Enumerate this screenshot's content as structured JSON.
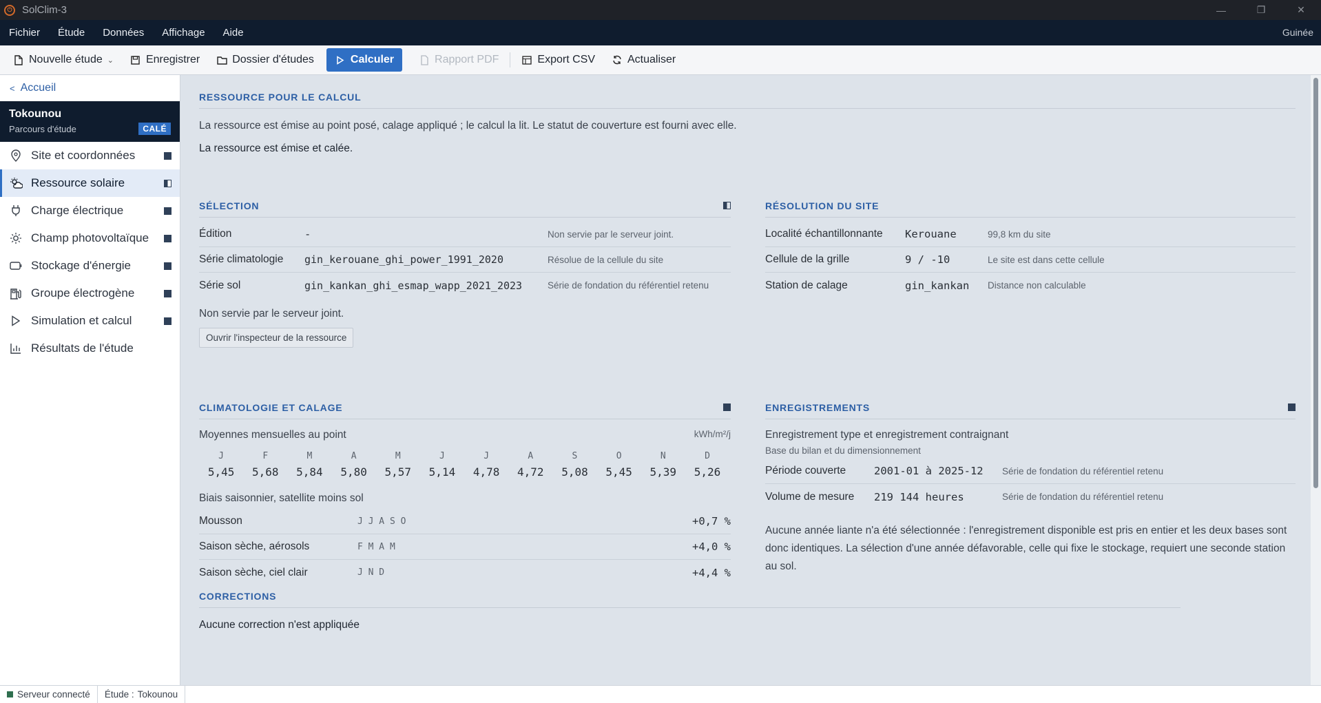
{
  "window": {
    "title": "SolClim-3",
    "minimize": "—",
    "restore": "❐",
    "close": "✕"
  },
  "menu": {
    "items": [
      "Fichier",
      "Étude",
      "Données",
      "Affichage",
      "Aide"
    ],
    "country": "Guinée"
  },
  "toolbar": {
    "new_study": "Nouvelle étude",
    "save": "Enregistrer",
    "folder": "Dossier d'études",
    "compute": "Calculer",
    "pdf": "Rapport PDF",
    "csv": "Export CSV",
    "refresh": "Actualiser"
  },
  "sidebar": {
    "back": "Accueil",
    "study_name": "Tokounou",
    "study_sub": "Parcours d'étude",
    "badge": "CALÉ",
    "items": [
      {
        "label": "Site et coordonnées",
        "icon": "map-pin-icon"
      },
      {
        "label": "Ressource solaire",
        "icon": "sun-cloud-icon"
      },
      {
        "label": "Charge électrique",
        "icon": "plug-icon"
      },
      {
        "label": "Champ photovoltaïque",
        "icon": "sun-icon"
      },
      {
        "label": "Stockage d'énergie",
        "icon": "battery-icon"
      },
      {
        "label": "Groupe électrogène",
        "icon": "generator-icon"
      },
      {
        "label": "Simulation et calcul",
        "icon": "play-icon"
      },
      {
        "label": "Résultats de l'étude",
        "icon": "bar-chart-icon"
      }
    ]
  },
  "resource": {
    "title": "RESSOURCE POUR LE CALCUL",
    "desc": "La ressource est émise au point posé, calage appliqué ; le calcul la lit. Le statut de couverture est fourni avec elle.",
    "status": "La ressource est émise et calée."
  },
  "selection": {
    "title": "SÉLECTION",
    "rows": [
      {
        "label": "Édition",
        "value": "-",
        "note": "Non servie par le serveur joint."
      },
      {
        "label": "Série climatologie",
        "value": "gin_kerouane_ghi_power_1991_2020",
        "note": "Résolue de la cellule du site"
      },
      {
        "label": "Série sol",
        "value": "gin_kankan_ghi_esmap_wapp_2021_2023",
        "note": "Série de fondation du référentiel retenu"
      }
    ],
    "footnote": "Non servie par le serveur joint.",
    "inspector_button": "Ouvrir l'inspecteur de la ressource"
  },
  "site_resolution": {
    "title": "RÉSOLUTION DU SITE",
    "rows": [
      {
        "label": "Localité échantillonnante",
        "value": "Kerouane",
        "note": "99,8 km du site"
      },
      {
        "label": "Cellule de la grille",
        "value": "9 / -10",
        "note": "Le site est dans cette cellule"
      },
      {
        "label": "Station de calage",
        "value": "gin_kankan",
        "note": "Distance non calculable"
      }
    ]
  },
  "climatology": {
    "title": "CLIMATOLOGIE ET CALAGE",
    "subtitle": "Moyennes mensuelles au point",
    "unit": "kWh/m²/j",
    "months": [
      "J",
      "F",
      "M",
      "A",
      "M",
      "J",
      "J",
      "A",
      "S",
      "O",
      "N",
      "D"
    ],
    "values": [
      "5,45",
      "5,68",
      "5,84",
      "5,80",
      "5,57",
      "5,14",
      "4,78",
      "4,72",
      "5,08",
      "5,45",
      "5,39",
      "5,26"
    ],
    "bias_title": "Biais saisonnier, satellite moins sol",
    "bias": [
      {
        "season": "Mousson",
        "months": "J J A S O",
        "value": "+0,7 %"
      },
      {
        "season": "Saison sèche, aérosols",
        "months": "F M A M",
        "value": "+4,0 %"
      },
      {
        "season": "Saison sèche, ciel clair",
        "months": "J N D",
        "value": "+4,4 %"
      }
    ]
  },
  "records": {
    "title": "ENREGISTREMENTS",
    "subtitle": "Enregistrement type et enregistrement contraignant",
    "sub2": "Base du bilan et du dimensionnement",
    "rows": [
      {
        "label": "Période couverte",
        "value": "2001-01 à 2025-12",
        "note": "Série de fondation du référentiel retenu"
      },
      {
        "label": "Volume de mesure",
        "value": "219 144 heures",
        "note": "Série de fondation du référentiel retenu"
      }
    ],
    "note": "Aucune année liante n'a été sélectionnée : l'enregistrement disponible est pris en entier et les deux bases sont donc identiques. La sélection d'une année défavorable, celle qui fixe le stockage, requiert une seconde station au sol."
  },
  "corrections": {
    "title": "CORRECTIONS",
    "text": "Aucune correction n'est appliquée"
  },
  "status": {
    "server": "Serveur connecté",
    "study_label": "Étude :",
    "study_value": "Tokounou"
  },
  "colors": {
    "accent": "#2f6fc4",
    "navy": "#0f1c2e",
    "section_title": "#2d5fa5"
  }
}
